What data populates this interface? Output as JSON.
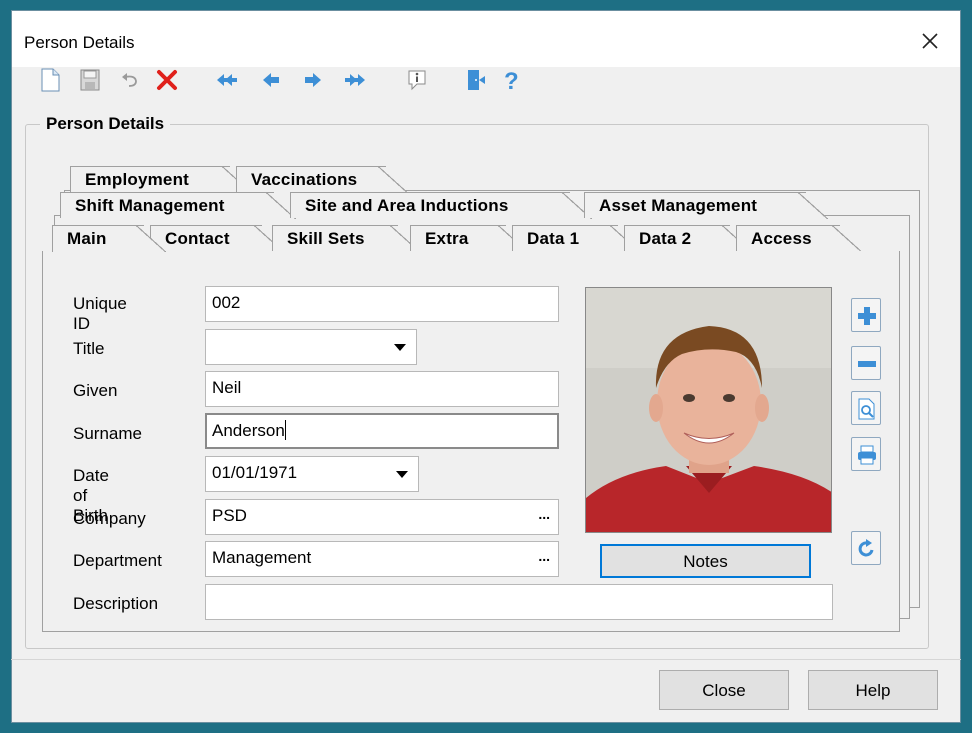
{
  "window": {
    "title": "Person Details"
  },
  "toolbar": {
    "icons": [
      "new-record-icon",
      "save-icon",
      "undo-icon",
      "delete-icon",
      "first-record-icon",
      "previous-record-icon",
      "next-record-icon",
      "last-record-icon",
      "info-icon",
      "exit-icon",
      "help-icon"
    ],
    "accent": "#3d8fd6",
    "delete_color": "#e0201b"
  },
  "group": {
    "label": "Person Details"
  },
  "tabs": {
    "row3": [
      "Employment",
      "Vaccinations"
    ],
    "row2": [
      "Shift Management",
      "Site and Area Inductions",
      "Asset Management"
    ],
    "row1": [
      "Main",
      "Contact",
      "Skill Sets",
      "Extra",
      "Data 1",
      "Data 2",
      "Access"
    ],
    "active": "Main"
  },
  "form": {
    "unique_id": {
      "label": "Unique ID",
      "value": "002"
    },
    "title": {
      "label": "Title",
      "value": ""
    },
    "given": {
      "label": "Given",
      "value": "Neil"
    },
    "surname": {
      "label": "Surname",
      "value": "Anderson"
    },
    "dob": {
      "label": "Date of Birth",
      "value": "01/01/1971"
    },
    "company": {
      "label": "Company",
      "value": "PSD",
      "button": "..."
    },
    "department": {
      "label": "Department",
      "value": "Management",
      "button": "..."
    },
    "description": {
      "label": "Description",
      "value": ""
    }
  },
  "photo": {
    "notes_label": "Notes"
  },
  "photo_buttons": [
    "add-photo-icon",
    "remove-photo-icon",
    "preview-photo-icon",
    "print-photo-icon",
    "rotate-photo-icon"
  ],
  "footer": {
    "close_label": "Close",
    "help_label": "Help"
  }
}
